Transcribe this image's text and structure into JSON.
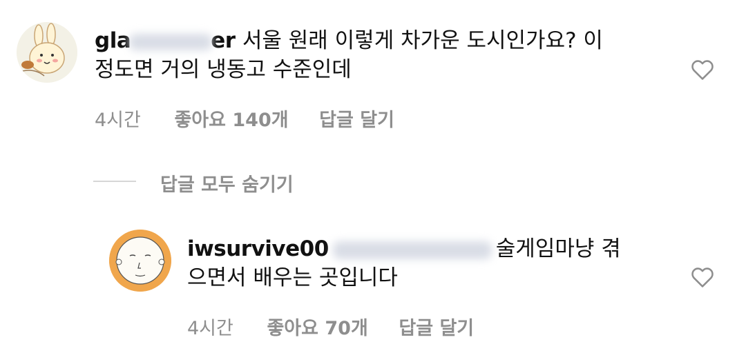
{
  "comments": [
    {
      "username_visible_start": "gla",
      "username_visible_end": "er",
      "text_line1": "서울 원래 이렇게 차가운 도시인가요? 이",
      "text_line2": "정도면 거의 냉동고 수준인데",
      "time": "4시간",
      "likes": "좋아요 140개",
      "reply": "답글 달기"
    },
    {
      "username": "iwsurvive00",
      "text_line1_tail": "술게임마냥 겪",
      "text_line2": "으면서 배우는 곳입니다",
      "time": "4시간",
      "likes": "좋아요 70개",
      "reply": "답글 달기"
    }
  ],
  "hide_replies": "답글 모두 숨기기",
  "icons": {
    "like": "heart-outline-icon"
  },
  "colors": {
    "meta_text": "#8e8e8e",
    "avatar2_bg": "#f0a64c"
  }
}
